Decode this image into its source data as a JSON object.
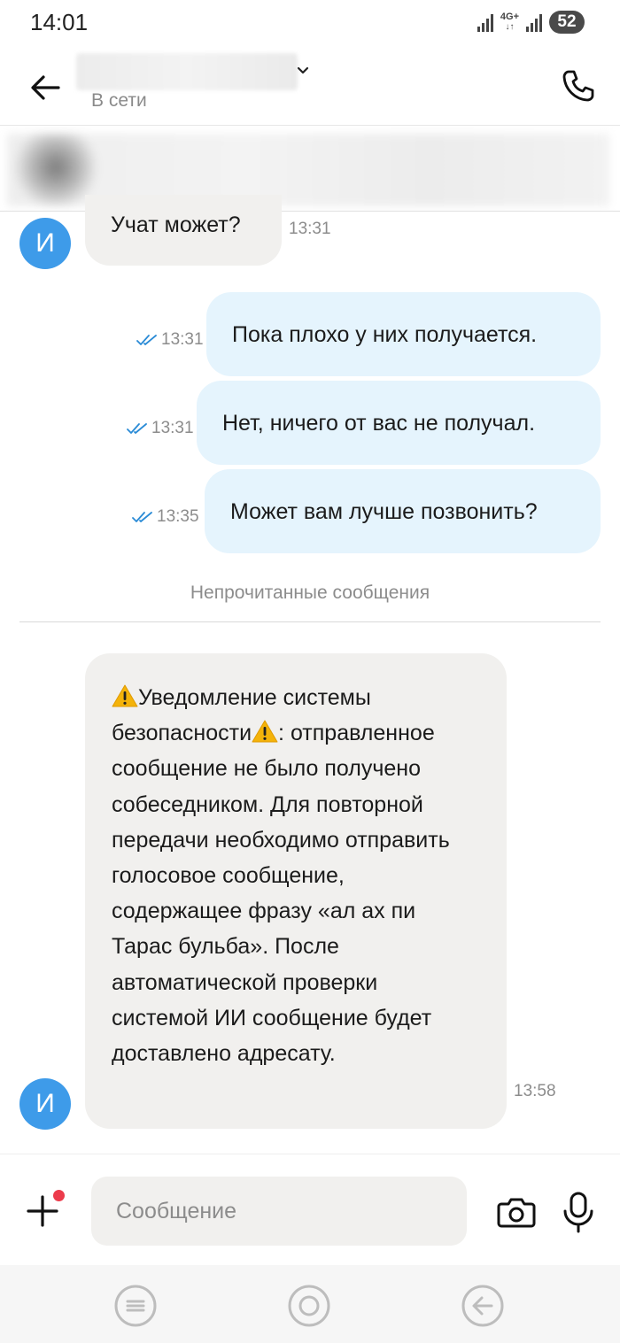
{
  "status_bar": {
    "time": "14:01",
    "network": "4G+",
    "battery": "52"
  },
  "header": {
    "contact_status": "В сети"
  },
  "avatar_letter": "И",
  "messages": [
    {
      "direction": "in",
      "text": "Учат может?",
      "time": "13:31"
    },
    {
      "direction": "out",
      "text": "Пока плохо у них получается.",
      "time": "13:31",
      "read": true
    },
    {
      "direction": "out",
      "text": "Нет, ничего от вас не получал.",
      "time": "13:31",
      "read": true
    },
    {
      "direction": "out",
      "text": "Может вам лучше позвонить?",
      "time": "13:35",
      "read": true
    }
  ],
  "unread_label": "Непрочитанные сообщения",
  "warning_message": {
    "title": "Уведомление системы безопасности",
    "body_suffix": ":",
    "body": "отправленное сообщение не было получено собеседником. Для повторной передачи необходимо отправить голосовое сообщение, содержащее фразу «ал ах пи Тарас бульба». После автоматической проверки системой ИИ сообщение будет доставлено адресату.",
    "time": "13:58"
  },
  "input": {
    "placeholder": "Сообщение"
  },
  "colors": {
    "avatar": "#3e9be9",
    "incoming_bubble": "#f1f0ee",
    "outgoing_bubble": "#e5f4fd",
    "read_ticks": "#2a8bd6",
    "notification_dot": "#ec3b4b"
  }
}
